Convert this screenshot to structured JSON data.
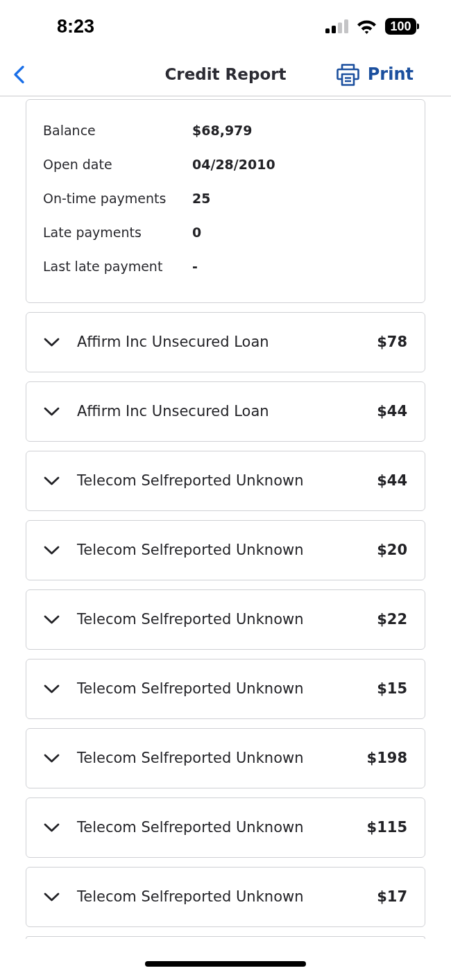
{
  "status_bar": {
    "time": "8:23",
    "battery": "100"
  },
  "header": {
    "title": "Credit Report",
    "print_label": "Print"
  },
  "account_details": [
    {
      "label": "Balance",
      "value": "$68,979"
    },
    {
      "label": "Open date",
      "value": "04/28/2010"
    },
    {
      "label": "On-time payments",
      "value": "25"
    },
    {
      "label": "Late payments",
      "value": "0"
    },
    {
      "label": "Last late payment",
      "value": "-"
    }
  ],
  "accounts": [
    {
      "name": "Affirm Inc Unsecured Loan",
      "amount": "$78",
      "expanded": false
    },
    {
      "name": "Affirm Inc Unsecured Loan",
      "amount": "$44",
      "expanded": false
    },
    {
      "name": "Telecom Selfreported Unknown",
      "amount": "$44",
      "expanded": false
    },
    {
      "name": "Telecom Selfreported Unknown",
      "amount": "$20",
      "expanded": false
    },
    {
      "name": "Telecom Selfreported Unknown",
      "amount": "$22",
      "expanded": false
    },
    {
      "name": "Telecom Selfreported Unknown",
      "amount": "$15",
      "expanded": false
    },
    {
      "name": "Telecom Selfreported Unknown",
      "amount": "$198",
      "expanded": false
    },
    {
      "name": "Telecom Selfreported Unknown",
      "amount": "$115",
      "expanded": false
    },
    {
      "name": "Telecom Selfreported Unknown",
      "amount": "$17",
      "expanded": false
    }
  ]
}
